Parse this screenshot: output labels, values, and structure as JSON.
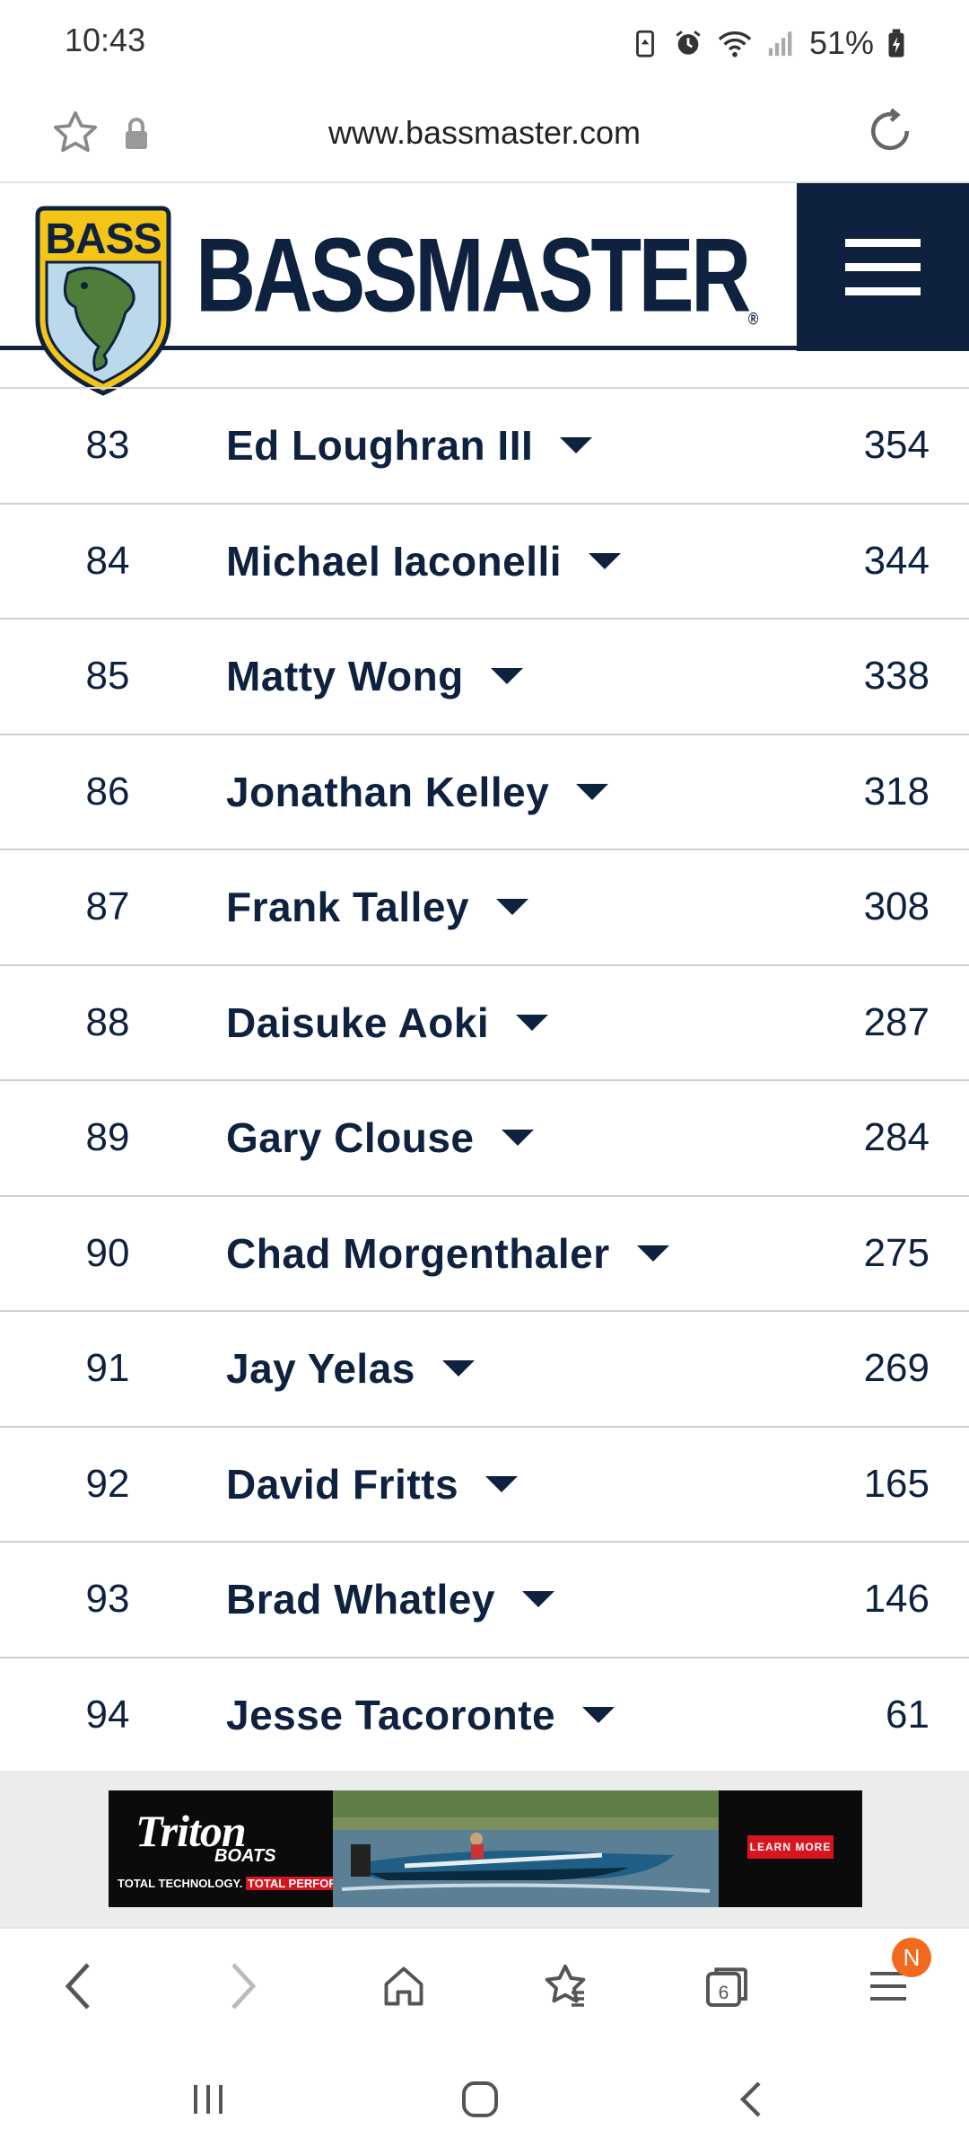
{
  "status_bar": {
    "time": "10:43",
    "battery": "51%"
  },
  "url_bar": {
    "url": "www.bassmaster.com"
  },
  "site_header": {
    "logo_badge_text": "BASS",
    "wordmark": "BASSMASTER",
    "registered_mark": "®",
    "colors": {
      "navy": "#0e2240",
      "gold": "#f4c417"
    }
  },
  "standings": [
    {
      "rank": "83",
      "name": "Ed Loughran III",
      "points": "354"
    },
    {
      "rank": "84",
      "name": "Michael Iaconelli",
      "points": "344"
    },
    {
      "rank": "85",
      "name": "Matty Wong",
      "points": "338"
    },
    {
      "rank": "86",
      "name": "Jonathan Kelley",
      "points": "318"
    },
    {
      "rank": "87",
      "name": "Frank Talley",
      "points": "308"
    },
    {
      "rank": "88",
      "name": "Daisuke Aoki",
      "points": "287"
    },
    {
      "rank": "89",
      "name": "Gary Clouse",
      "points": "284"
    },
    {
      "rank": "90",
      "name": "Chad Morgenthaler",
      "points": "275"
    },
    {
      "rank": "91",
      "name": "Jay Yelas",
      "points": "269"
    },
    {
      "rank": "92",
      "name": "David Fritts",
      "points": "165"
    },
    {
      "rank": "93",
      "name": "Brad Whatley",
      "points": "146"
    },
    {
      "rank": "94",
      "name": "Jesse Tacoronte",
      "points": "61"
    }
  ],
  "ad": {
    "brand": "Triton",
    "brand_sub": "BOATS",
    "tagline_white": "TOTAL TECHNOLOGY.",
    "tagline_red": "TOTAL PERFORMANCE.",
    "cta": "LEARN MORE"
  },
  "browser_toolbar": {
    "tabs_count": "6",
    "menu_badge": "N",
    "icons": [
      "back-icon",
      "forward-icon",
      "home-icon",
      "bookmarks-icon",
      "tabs-icon",
      "menu-icon"
    ]
  },
  "system_nav": {
    "icons": [
      "recent-apps-icon",
      "home-icon",
      "back-icon"
    ]
  }
}
